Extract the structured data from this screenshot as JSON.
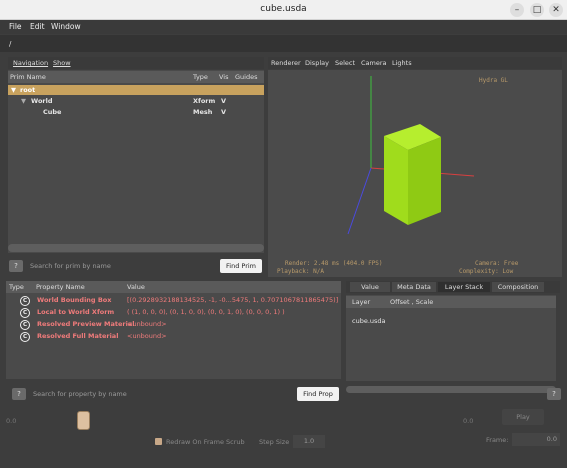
{
  "window": {
    "title": "cube.usda"
  },
  "menu": [
    "File",
    "Edit",
    "Window"
  ],
  "path": "/",
  "prim_panel": {
    "tabs": [
      "Navigation",
      "Show"
    ],
    "headers": {
      "name": "Prim Name",
      "type": "Type",
      "vis": "Vis",
      "guides": "Guides"
    },
    "rows": [
      {
        "name": "root",
        "type": "",
        "vis": ""
      },
      {
        "name": "World",
        "type": "Xform",
        "vis": "V"
      },
      {
        "name": "Cube",
        "type": "Mesh",
        "vis": "V"
      }
    ],
    "help_label": "?",
    "search_placeholder": "Search for prim by name",
    "find_button": "Find Prim"
  },
  "viewport": {
    "menu": [
      "Renderer",
      "Display",
      "Select",
      "Camera",
      "Lights"
    ],
    "renderer_name": "Hydra GL",
    "render_stat": "Render: 2.48 ms (404.0 FPS)",
    "playback_stat": "Playback: N/A",
    "camera_stat": "Camera: Free",
    "complexity_stat": "Complexity: Low",
    "colors": {
      "cube": "#9cd81a",
      "x_axis": "#d84040",
      "y_axis": "#3ec23e",
      "z_axis": "#4a4ae0"
    }
  },
  "property_panel": {
    "headers": {
      "type": "Type",
      "name": "Property Name",
      "value": "Value"
    },
    "rows": [
      {
        "icon": "C",
        "name": "World Bounding Box",
        "value": "[(0.2928932188134525, -1, -0...5475, 1, 0.7071067811865475)]"
      },
      {
        "icon": "C",
        "name": "Local to World Xform",
        "value": "( (1, 0, 0, 0), (0, 1, 0, 0), (0, 0, 1, 0), (0, 0, 0, 1) )"
      },
      {
        "icon": "C",
        "name": "Resolved Preview Material",
        "value": "<unbound>"
      },
      {
        "icon": "C",
        "name": "Resolved Full Material",
        "value": "<unbound>"
      }
    ],
    "help_label": "?",
    "search_placeholder": "Search for property by name",
    "find_button": "Find Prop"
  },
  "layer_panel": {
    "tabs": [
      "Value",
      "Meta Data",
      "Layer Stack",
      "Composition"
    ],
    "active_tab": "Layer Stack",
    "headers": {
      "layer": "Layer",
      "offset": "Offset , Scale"
    },
    "rows": [
      "cube.usda"
    ],
    "help_label": "?"
  },
  "timeline": {
    "start_value": "0.0",
    "end_value": "0.0",
    "play_button": "Play",
    "redraw_label": "Redraw On Frame Scrub",
    "step_label": "Step Size",
    "step_value": "1.0",
    "frame_label": "Frame:",
    "frame_value": "0.0"
  }
}
